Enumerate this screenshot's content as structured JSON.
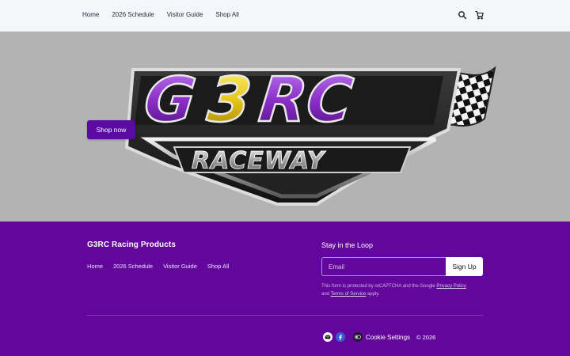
{
  "header": {
    "nav": [
      "Home",
      "2026 Schedule",
      "Visitor Guide",
      "Shop All"
    ],
    "icons": [
      "search-icon",
      "cart-icon"
    ]
  },
  "hero": {
    "logo_text_top": "G3RC",
    "logo_text_bottom": "RACEWAY",
    "cta": "Shop now",
    "colors": {
      "background": "#b3b3b3",
      "cta_bg": "#5a0aa0",
      "logo_purple": "#8b2fc9",
      "logo_yellow": "#e6c619"
    }
  },
  "footer": {
    "brand": "G3RC Racing Products",
    "nav": [
      "Home",
      "2026 Schedule",
      "Visitor Guide",
      "Shop All"
    ],
    "newsletter": {
      "title": "Stay in the Loop",
      "placeholder": "Email",
      "button": "Sign Up",
      "recaptcha_prefix": "This form is protected by reCAPTCHA and the Google",
      "privacy_link": "Privacy Policy",
      "and": "and",
      "terms_link": "Terms of Service",
      "suffix": "apply."
    },
    "social_icons": [
      "mail-icon",
      "facebook-icon"
    ],
    "cookie_settings": "Cookie Settings",
    "copyright": "© 2026",
    "colors": {
      "background": "#63069c"
    }
  }
}
